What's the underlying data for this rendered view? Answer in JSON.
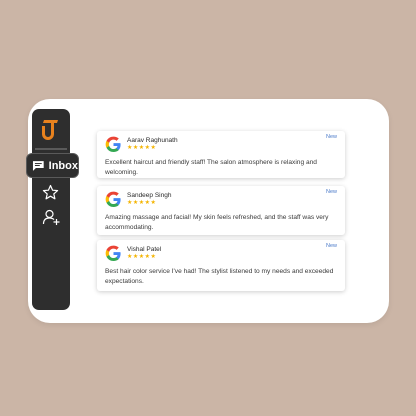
{
  "nav": {
    "inbox_label": "Inbox"
  },
  "reviews": [
    {
      "name": "Aarav Raghunath",
      "stars": "★★★★★",
      "badge": "New",
      "text": "Excellent haircut and friendly staff! The salon atmosphere is relaxing and welcoming."
    },
    {
      "name": "Sandeep Singh",
      "stars": "★★★★★",
      "badge": "New",
      "text": "Amazing massage and facial! My skin feels refreshed, and the staff was very accommodating."
    },
    {
      "name": "Vishal Patel",
      "stars": "★★★★★",
      "badge": "New",
      "text": "Best hair color service I've had! The stylist listened to my needs and exceeded expectations."
    }
  ],
  "colors": {
    "background": "#cbb5a6",
    "sidebar": "#2e2e2e",
    "brand_orange": "#e8821e",
    "star": "#f4b400",
    "badge": "#4a79c8"
  },
  "icons": [
    "brand-logo-icon",
    "chat-icon",
    "star-icon",
    "add-user-icon",
    "google-icon"
  ]
}
